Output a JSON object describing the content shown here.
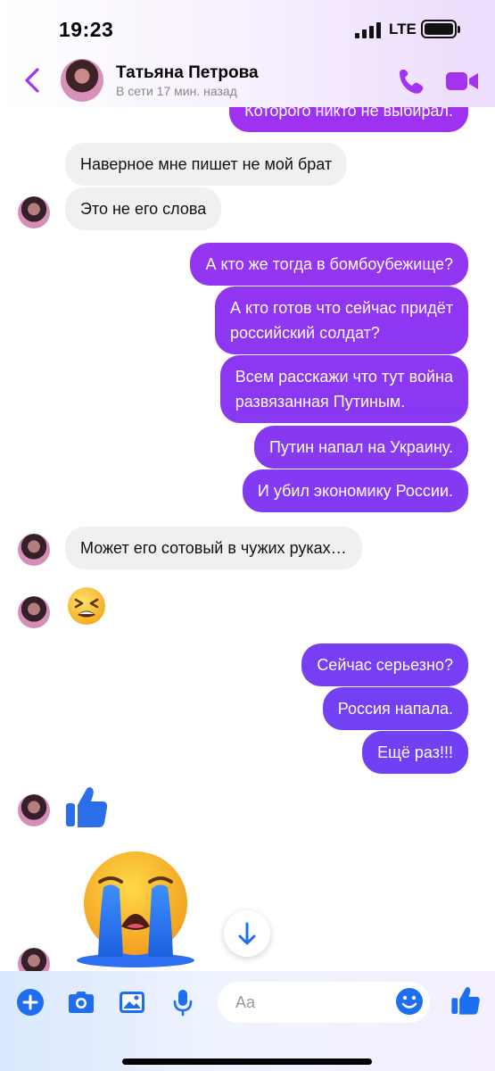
{
  "status_bar": {
    "time": "19:23",
    "network": "LTE"
  },
  "contact": {
    "name": "Татьяна Петрова",
    "status": "В сети 17 мин. назад"
  },
  "icons": {
    "back": "chevron-left-icon",
    "call": "phone-icon",
    "video": "video-camera-icon",
    "add": "plus-icon",
    "camera": "camera-icon",
    "gallery": "image-icon",
    "mic": "microphone-icon",
    "emoji": "smiley-icon",
    "like": "thumbs-up-icon",
    "scroll": "arrow-down-icon"
  },
  "colors": {
    "accent": "#a234f0",
    "outgoing_top": "#a62ff0",
    "outgoing_bottom": "#5a48f5",
    "incoming_bg": "#f0f0f0",
    "composer_icon": "#1e6ef0"
  },
  "messages": [
    {
      "dir": "out",
      "text": "Которого никто не выбирал."
    },
    {
      "dir": "in",
      "text": "Наверное мне пишет не мой брат"
    },
    {
      "dir": "in",
      "text": "Это не его слова"
    },
    {
      "dir": "out",
      "text": "А кто же тогда в бомбоубежище?"
    },
    {
      "dir": "out",
      "text": "А кто готов что сейчас придёт\nроссийский солдат?"
    },
    {
      "dir": "out",
      "text": "Всем расскажи что тут война\nразвязанная Путиным."
    },
    {
      "dir": "out",
      "text": "Путин напал на Украину."
    },
    {
      "dir": "out",
      "text": "И убил экономику России."
    },
    {
      "dir": "in",
      "text": "Может  его сотовый в чужих руках…"
    },
    {
      "dir": "in",
      "emoji": "tired-face-emoji"
    },
    {
      "dir": "out",
      "text": "Сейчас серьезно?"
    },
    {
      "dir": "out",
      "text": "Россия напала."
    },
    {
      "dir": "out",
      "text": "Ещё раз!!!"
    },
    {
      "dir": "in",
      "emoji": "thumbs-up-icon"
    },
    {
      "dir": "in",
      "emoji": "loudly-crying-face-emoji"
    }
  ],
  "composer": {
    "placeholder": "Aa"
  }
}
